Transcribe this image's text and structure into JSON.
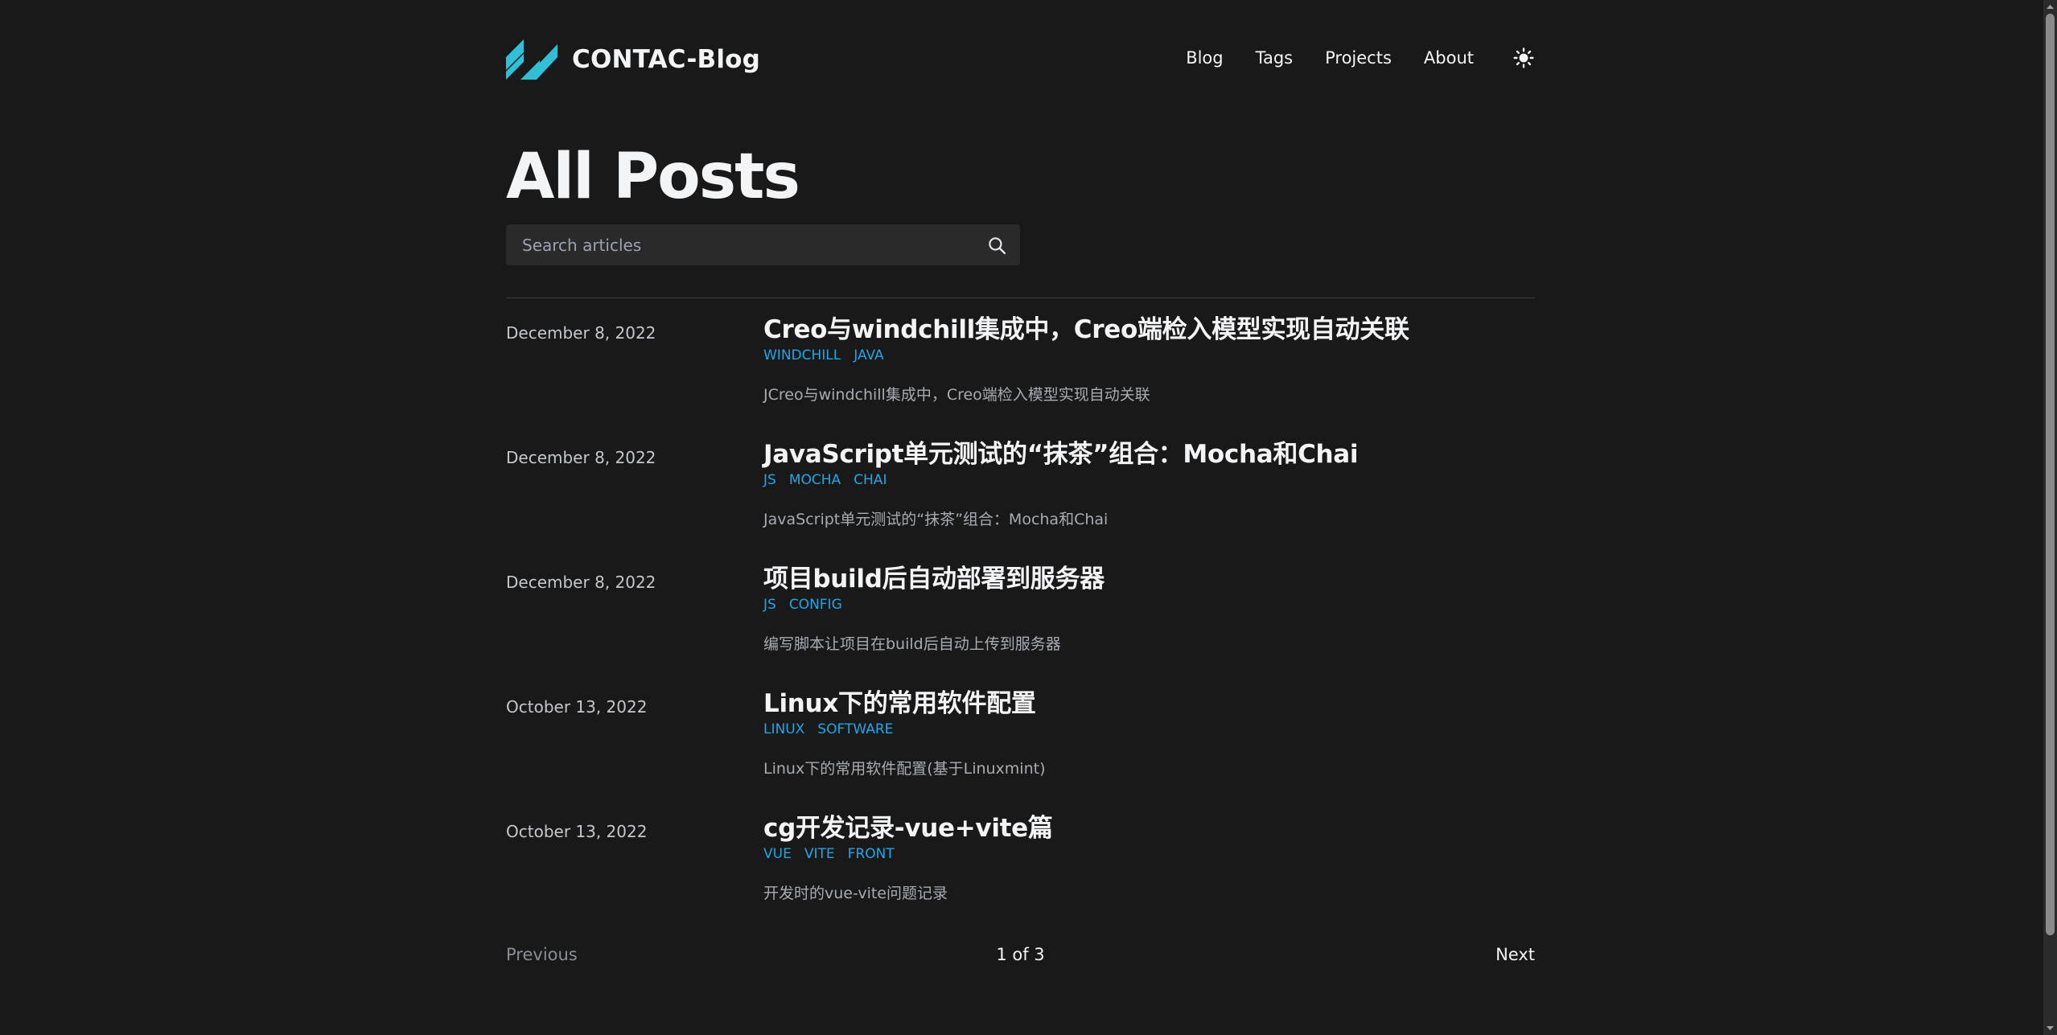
{
  "header": {
    "site_name": "CONTAC-Blog",
    "accent_color": "#2fc0d8",
    "nav": [
      {
        "label": "Blog"
      },
      {
        "label": "Tags"
      },
      {
        "label": "Projects"
      },
      {
        "label": "About"
      }
    ],
    "theme_toggle_icon": "sun-icon"
  },
  "main": {
    "title": "All Posts",
    "search": {
      "placeholder": "Search articles",
      "value": ""
    },
    "posts": [
      {
        "date": "December 8, 2022",
        "title": "Creo与windchill集成中，Creo端检入模型实现自动关联",
        "tags": [
          "WINDCHILL",
          "JAVA"
        ],
        "summary": "JCreo与windchill集成中，Creo端检入模型实现自动关联"
      },
      {
        "date": "December 8, 2022",
        "title": "JavaScript单元测试的“抹茶”组合：Mocha和Chai",
        "tags": [
          "JS",
          "MOCHA",
          "CHAI"
        ],
        "summary": "JavaScript单元测试的“抹茶”组合：Mocha和Chai"
      },
      {
        "date": "December 8, 2022",
        "title": "项目build后自动部署到服务器",
        "tags": [
          "JS",
          "CONFIG"
        ],
        "summary": "编写脚本让项目在build后自动上传到服务器"
      },
      {
        "date": "October 13, 2022",
        "title": "Linux下的常用软件配置",
        "tags": [
          "LINUX",
          "SOFTWARE"
        ],
        "summary": "Linux下的常用软件配置(基于Linuxmint)"
      },
      {
        "date": "October 13, 2022",
        "title": "cg开发记录-vue+vite篇",
        "tags": [
          "VUE",
          "VITE",
          "FRONT"
        ],
        "summary": "开发时的vue-vite问题记录"
      }
    ],
    "tag_color": "#1ea7e6"
  },
  "pagination": {
    "previous_label": "Previous",
    "status": "1 of 3",
    "next_label": "Next"
  }
}
